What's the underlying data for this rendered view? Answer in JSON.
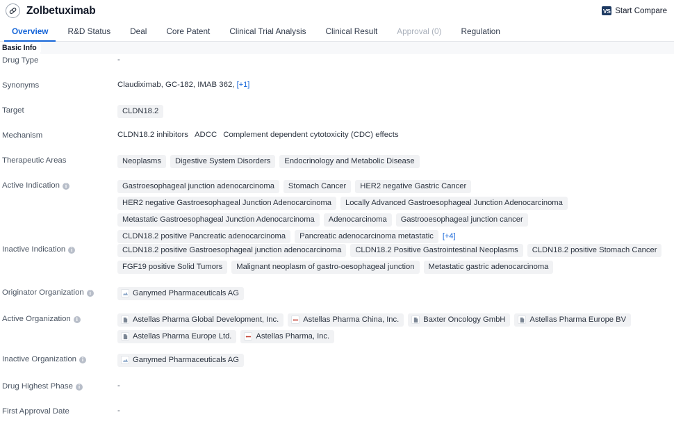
{
  "header": {
    "drug_icon": "pill-capsule-icon",
    "title": "Zolbetuximab",
    "compare_badge": "VS",
    "compare_label": "Start Compare"
  },
  "tabs": [
    {
      "label": "Overview",
      "state": "active"
    },
    {
      "label": "R&D Status",
      "state": "normal"
    },
    {
      "label": "Deal",
      "state": "normal"
    },
    {
      "label": "Core Patent",
      "state": "normal"
    },
    {
      "label": "Clinical Trial Analysis",
      "state": "normal"
    },
    {
      "label": "Clinical Result",
      "state": "normal"
    },
    {
      "label": "Approval (0)",
      "state": "disabled"
    },
    {
      "label": "Regulation",
      "state": "normal"
    }
  ],
  "section": {
    "title": "Basic Info"
  },
  "rows": {
    "drug_type": {
      "label": "Drug Type",
      "value": "-"
    },
    "synonyms": {
      "label": "Synonyms",
      "items": [
        "Claudiximab",
        "GC-182",
        "IMAB 362"
      ],
      "more": "[+1]"
    },
    "target": {
      "label": "Target",
      "tags": [
        "CLDN18.2"
      ]
    },
    "mechanism": {
      "label": "Mechanism",
      "items": [
        "CLDN18.2 inhibitors",
        "ADCC",
        "Complement dependent cytotoxicity (CDC) effects"
      ]
    },
    "therapeutic_areas": {
      "label": "Therapeutic Areas",
      "tags": [
        "Neoplasms",
        "Digestive System Disorders",
        "Endocrinology and Metabolic Disease"
      ]
    },
    "active_indication": {
      "label": "Active Indication",
      "has_info": true,
      "tags": [
        "Gastroesophageal junction adenocarcinoma",
        "Stomach Cancer",
        "HER2 negative Gastric Cancer",
        "HER2 negative Gastroesophageal Junction Adenocarcinoma",
        "Locally Advanced Gastroesophageal Junction Adenocarcinoma",
        "Metastatic Gastroesophageal Junction Adenocarcinoma",
        "Adenocarcinoma",
        "Gastrooesophageal junction cancer",
        "CLDN18.2 positive Pancreatic adenocarcinoma",
        "Pancreatic adenocarcinoma metastatic"
      ],
      "more": "[+4]"
    },
    "inactive_indication": {
      "label": "Inactive Indication",
      "has_info": true,
      "tags": [
        "CLDN18.2 positive Gastroesophageal junction adenocarcinoma",
        "CLDN18.2 Positive Gastrointestinal Neoplasms",
        "CLDN18.2 positive Stomach Cancer",
        "FGF19 positive Solid Tumors",
        "Malignant neoplasm of gastro-oesophageal junction",
        "Metastatic gastric adenocarcinoma"
      ]
    },
    "originator_organization": {
      "label": "Originator Organization",
      "has_info": true,
      "orgs": [
        {
          "name": "Ganymed Pharmaceuticals AG",
          "logo": "ganymed-logo-icon",
          "logo_color": "#8aa6c8"
        }
      ]
    },
    "active_organization": {
      "label": "Active Organization",
      "has_info": true,
      "orgs": [
        {
          "name": "Astellas Pharma Global Development, Inc.",
          "logo": "astellas-doc-logo-icon",
          "logo_color": "#7b8694"
        },
        {
          "name": "Astellas Pharma China, Inc.",
          "logo": "astellas-red-logo-icon",
          "logo_color": "#c0392b"
        },
        {
          "name": "Baxter Oncology GmbH",
          "logo": "baxter-doc-logo-icon",
          "logo_color": "#7b8694"
        },
        {
          "name": "Astellas Pharma Europe BV",
          "logo": "astellas-doc-logo-icon",
          "logo_color": "#7b8694"
        },
        {
          "name": "Astellas Pharma Europe Ltd.",
          "logo": "astellas-doc-logo-icon",
          "logo_color": "#7b8694"
        },
        {
          "name": "Astellas Pharma, Inc.",
          "logo": "astellas-red-logo-icon",
          "logo_color": "#c0392b"
        }
      ]
    },
    "inactive_organization": {
      "label": "Inactive Organization",
      "has_info": true,
      "orgs": [
        {
          "name": "Ganymed Pharmaceuticals AG",
          "logo": "ganymed-logo-icon",
          "logo_color": "#8aa6c8"
        }
      ]
    },
    "drug_highest_phase": {
      "label": "Drug Highest Phase",
      "has_info": true,
      "value": "-"
    },
    "first_approval_date": {
      "label": "First Approval Date",
      "value": "-"
    }
  },
  "colors": {
    "accent": "#1565d8",
    "chip_bg": "#f1f2f4",
    "badge_navy": "#1e3a62",
    "label_text": "#4b5563"
  }
}
